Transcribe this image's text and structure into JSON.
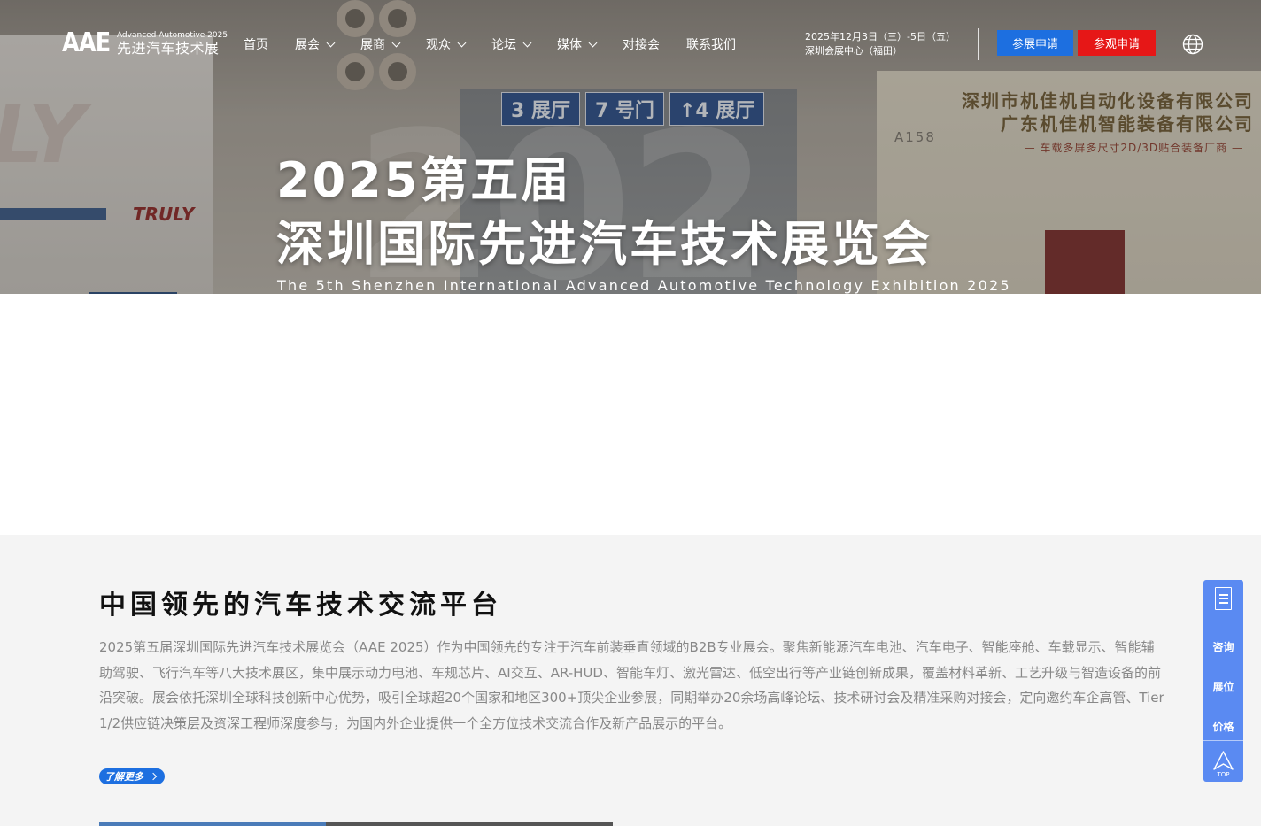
{
  "header": {
    "logo_mark": "AAE",
    "logo_en": "Advanced Automotive 2025",
    "logo_cn": "先进汽车技术展",
    "nav": [
      {
        "label": "首页",
        "dropdown": false
      },
      {
        "label": "展会",
        "dropdown": true
      },
      {
        "label": "展商",
        "dropdown": true
      },
      {
        "label": "观众",
        "dropdown": true
      },
      {
        "label": "论坛",
        "dropdown": true
      },
      {
        "label": "媒体",
        "dropdown": true
      },
      {
        "label": "对接会",
        "dropdown": false
      },
      {
        "label": "联系我们",
        "dropdown": false
      }
    ],
    "event_date": "2025年12月3日（三）-5日（五）",
    "event_venue": "深圳会展中心（福田）",
    "exhibit_button": "参展申请",
    "visit_button": "参观申请",
    "language_icon": "globe-icon"
  },
  "hero": {
    "title_line1": "2025第五届",
    "title_line2": "深圳国际先进汽车技术展览会",
    "subtitle_en": "The 5th Shenzhen International Advanced Automotive Technology Exhibition 2025",
    "background": {
      "left_brand": "LY",
      "left_brand2": "TRULY",
      "signs": [
        "3 展厅",
        "7 号门",
        "↑4 展厅"
      ],
      "right_company1": "深圳市机佳机自动化设备有限公司",
      "right_company2": "广东机佳机智能装备有限公司",
      "right_slogan": "— 车载多屏多尺寸2D/3D贴合装备厂商 —",
      "stand_code": "A158"
    }
  },
  "intro": {
    "title": "中国领先的汽车技术交流平台",
    "body": "2025第五届深圳国际先进汽车技术展览会（AAE 2025）作为中国领先的专注于汽车前装垂直领域的B2B专业展会。聚焦新能源汽车电池、汽车电子、智能座舱、车载显示、智能辅助驾驶、飞行汽车等八大技术展区，集中展示动力电池、车规芯片、AI交互、AR-HUD、智能车灯、激光雷达、低空出行等产业链创新成果，覆盖材料革新、工艺升级与智造设备的前沿突破。展会依托深圳全球科技创新中心优势，吸引全球超20个国家和地区300+顶尖企业参展，同期举办20余场高峰论坛、技术研讨会及精准采购对接会，定向邀约车企高管、Tier 1/2供应链决策层及资深工程师深度参与，为国内外企业提供一个全方位技术交流合作及新产品展示的平台。",
    "more_button": "了解更多"
  },
  "float_bar": {
    "doc_icon": "document-icon",
    "consult": "咨询",
    "booth": "展位",
    "price": "价格",
    "top_label": "TOP"
  },
  "colors": {
    "accent_blue": "#1d6fe0",
    "accent_red": "#e61717",
    "float_blue": "#5a8af2",
    "intro_bg": "#f4f4f4"
  }
}
